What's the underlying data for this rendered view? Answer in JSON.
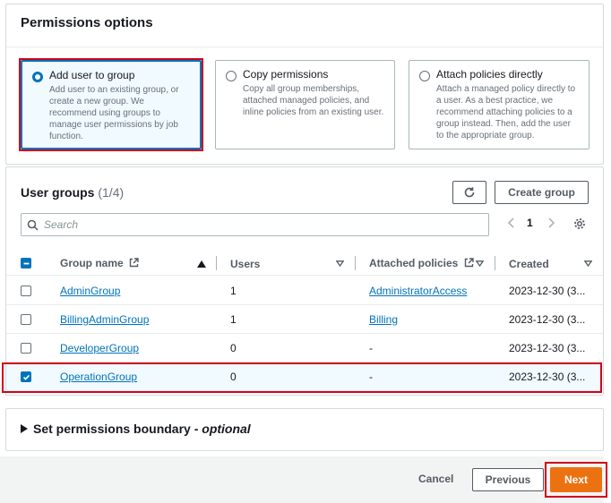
{
  "permissions": {
    "title": "Permissions options",
    "options": [
      {
        "title": "Add user to group",
        "desc": "Add user to an existing group, or create a new group. We recommend using groups to manage user permissions by job function.",
        "selected": true
      },
      {
        "title": "Copy permissions",
        "desc": "Copy all group memberships, attached managed policies, and inline policies from an existing user.",
        "selected": false
      },
      {
        "title": "Attach policies directly",
        "desc": "Attach a managed policy directly to a user. As a best practice, we recommend attaching policies to a group instead. Then, add the user to the appropriate group.",
        "selected": false
      }
    ]
  },
  "groups": {
    "title": "User groups",
    "count": "(1/4)",
    "create_label": "Create group",
    "search_placeholder": "Search",
    "page": "1",
    "columns": {
      "name": "Group name",
      "users": "Users",
      "policies": "Attached policies",
      "created": "Created"
    },
    "rows": [
      {
        "name": "AdminGroup",
        "users": "1",
        "policy": "AdministratorAccess",
        "created": "2023-12-30 (3...",
        "checked": false
      },
      {
        "name": "BillingAdminGroup",
        "users": "1",
        "policy": "Billing",
        "created": "2023-12-30 (3...",
        "checked": false
      },
      {
        "name": "DeveloperGroup",
        "users": "0",
        "policy": "-",
        "created": "2023-12-30 (3...",
        "checked": false
      },
      {
        "name": "OperationGroup",
        "users": "0",
        "policy": "-",
        "created": "2023-12-30 (3...",
        "checked": true
      }
    ]
  },
  "boundary": {
    "label": "Set permissions boundary - ",
    "optional": "optional"
  },
  "footer": {
    "cancel": "Cancel",
    "previous": "Previous",
    "next": "Next"
  },
  "colors": {
    "accent": "#0073bb",
    "primary_button": "#ec7211",
    "highlight_border": "#d0021b"
  }
}
